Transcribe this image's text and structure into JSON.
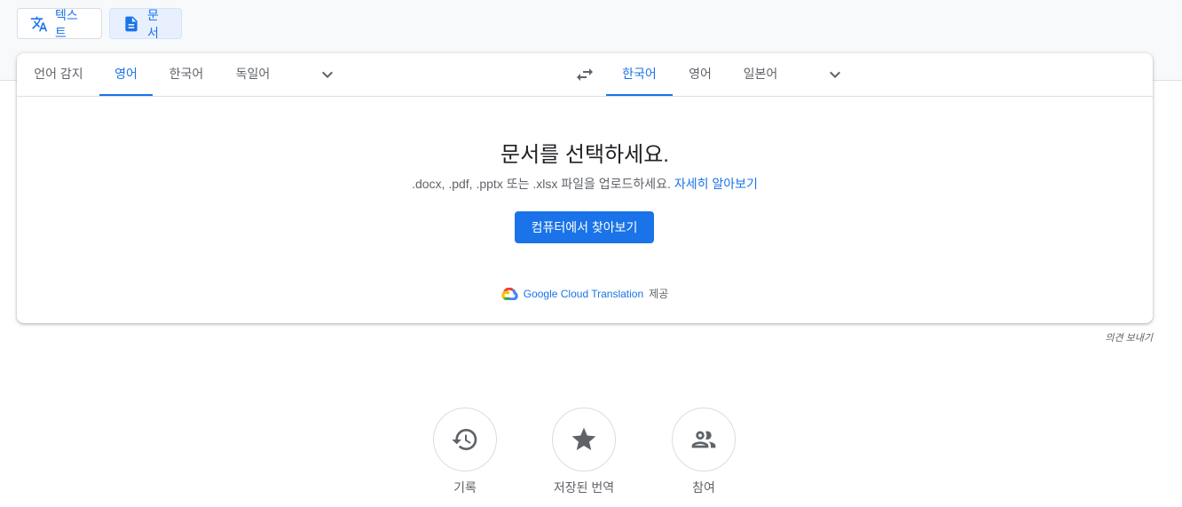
{
  "modes": {
    "text_label": "텍스트",
    "document_label": "문서"
  },
  "source_langs": [
    "언어 감지",
    "영어",
    "한국어",
    "독일어"
  ],
  "target_langs": [
    "한국어",
    "영어",
    "일본어"
  ],
  "upload": {
    "title": "문서를 선택하세요.",
    "description": ".docx, .pdf, .pptx 또는 .xlsx 파일을 업로드하세요.",
    "learn_more": "자세히 알아보기",
    "browse_button": "컴퓨터에서 찾아보기"
  },
  "powered_by": {
    "brand": "Google Cloud Translation",
    "suffix": "제공"
  },
  "feedback": "의견 보내기",
  "bottom": {
    "history": "기록",
    "saved": "저장된 번역",
    "contribute": "참여"
  },
  "colors": {
    "accent": "#1a73e8",
    "text_secondary": "#5f6368"
  }
}
